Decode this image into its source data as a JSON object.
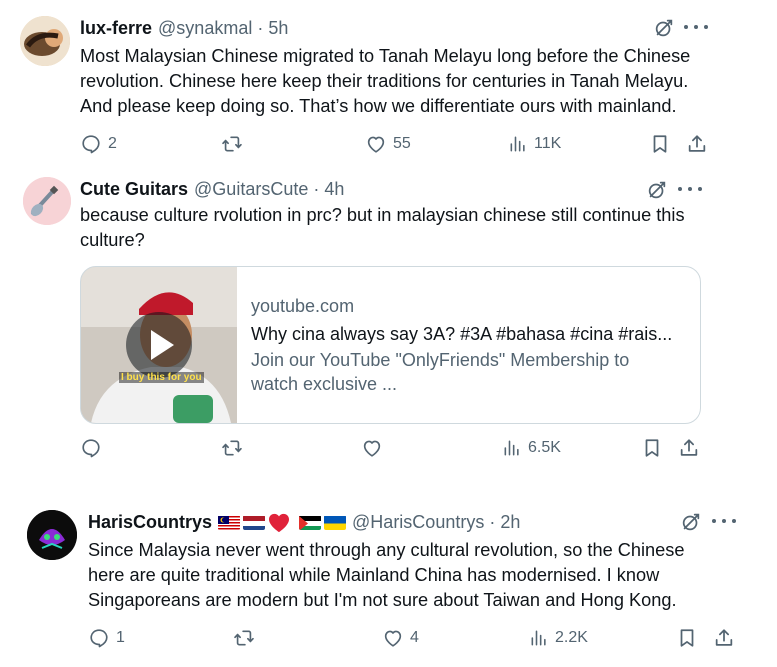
{
  "tweets": [
    {
      "name": "lux-ferre",
      "handle": "@synakmal · 5h",
      "text": [
        "Most Malaysian Chinese migrated to Tanah Melayu long before the Chinese",
        "revolution. Chinese here keep their traditions for centuries in Tanah Melayu.",
        "And please keep doing so. That’s how we differentiate ours with mainland."
      ],
      "replies": "2",
      "reposts": "",
      "likes": "55",
      "views": "11K"
    },
    {
      "name": "Cute Guitars",
      "handle": "@GuitarsCute · 4h",
      "text": [
        "because culture rvolution in prc? but in malaysian chinese still continue this",
        "culture?"
      ],
      "card": {
        "domain": "youtube.com",
        "title": "Why cina always say 3A? #3A #bahasa #cina #rais...",
        "description": [
          "Join our YouTube \"OnlyFriends\" Membership to",
          "watch exclusive ..."
        ],
        "thumbnail_caption": "I buy this for you"
      },
      "replies": "",
      "reposts": "",
      "likes": "",
      "views": "6.5K"
    },
    {
      "name": "HarisCountrys",
      "handle": "@HarisCountrys · 2h",
      "flags": [
        "malaysia-flag",
        "netherlands-flag",
        "red-heart",
        "palestine-flag",
        "ukraine-flag"
      ],
      "text": [
        "Since Malaysia never went through any cultural revolution, so the Chinese",
        "here are quite traditional while Mainland China has modernised. I know",
        "Singaporeans are modern but I'm not sure about Taiwan and Hong Kong."
      ],
      "replies": "1",
      "reposts": "",
      "likes": "4",
      "views": "2.2K"
    }
  ],
  "colors": {
    "text": "#0f1419",
    "secondary": "#536471",
    "border": "#cfd9de"
  },
  "icons": [
    "grok-icon",
    "more-icon",
    "reply-icon",
    "repost-icon",
    "like-icon",
    "views-icon",
    "bookmark-icon",
    "share-icon",
    "play-icon"
  ]
}
